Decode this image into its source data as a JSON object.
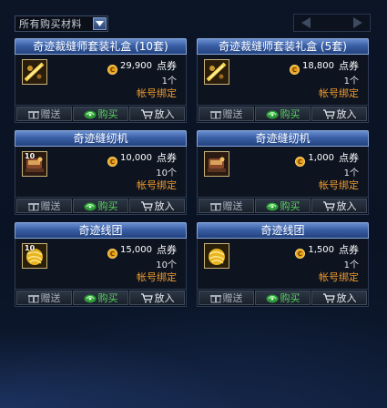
{
  "filter": {
    "label": "所有购买材料"
  },
  "items": [
    {
      "title": "奇迹裁缝师套装礼盒 (10套)",
      "price": "29,900",
      "unit": "点券",
      "count": "1个",
      "binding": "帐号绑定",
      "qty": "",
      "icon": "gift-box-icon"
    },
    {
      "title": "奇迹裁缝师套装礼盒 (5套)",
      "price": "18,800",
      "unit": "点券",
      "count": "1个",
      "binding": "帐号绑定",
      "qty": "",
      "icon": "gift-box-icon"
    },
    {
      "title": "奇迹缝纫机",
      "price": "10,000",
      "unit": "点券",
      "count": "10个",
      "binding": "帐号绑定",
      "qty": "10",
      "icon": "sewing-machine-icon"
    },
    {
      "title": "奇迹缝纫机",
      "price": "1,000",
      "unit": "点券",
      "count": "1个",
      "binding": "帐号绑定",
      "qty": "",
      "icon": "sewing-machine-icon"
    },
    {
      "title": "奇迹线团",
      "price": "15,000",
      "unit": "点券",
      "count": "10个",
      "binding": "帐号绑定",
      "qty": "10",
      "icon": "yarn-ball-icon"
    },
    {
      "title": "奇迹线团",
      "price": "1,500",
      "unit": "点券",
      "count": "1个",
      "binding": "帐号绑定",
      "qty": "",
      "icon": "yarn-ball-icon"
    }
  ],
  "buttons": {
    "gift": "赠送",
    "buy": "购买",
    "cart": "放入"
  },
  "colors": {
    "header": "#3a5fa6",
    "binding": "#f09a2c",
    "buy": "#59d05e"
  }
}
